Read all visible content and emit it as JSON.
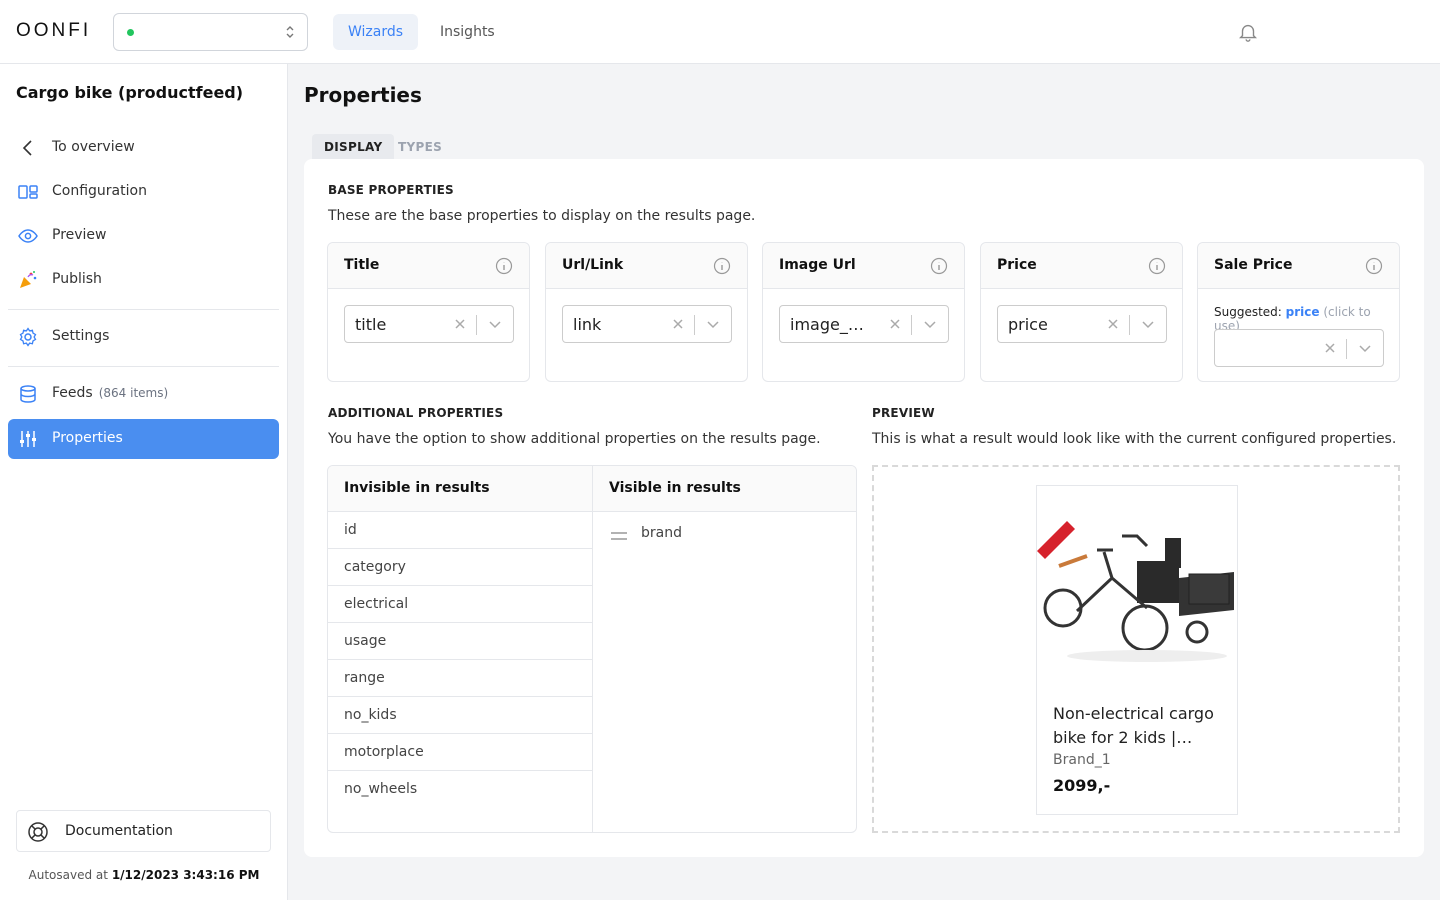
{
  "app": {
    "logo": "OONFI"
  },
  "topnav": {
    "tabs": [
      {
        "label": "Wizards",
        "active": true
      },
      {
        "label": "Insights",
        "active": false
      }
    ]
  },
  "sidebar": {
    "feed_title": "Cargo bike (productfeed)",
    "items": [
      {
        "label": "To overview",
        "icon": "chevron-left-icon"
      },
      {
        "label": "Configuration",
        "icon": "layout-icon"
      },
      {
        "label": "Preview",
        "icon": "eye-icon"
      },
      {
        "label": "Publish",
        "icon": "party-popper-icon"
      },
      {
        "label": "Settings",
        "icon": "gear-icon"
      },
      {
        "label": "Feeds",
        "count": "(864 items)",
        "icon": "database-icon"
      },
      {
        "label": "Properties",
        "icon": "sliders-icon",
        "active": true
      }
    ],
    "documentation": "Documentation",
    "autosave_prefix": "Autosaved at",
    "autosave_time": "1/12/2023 3:43:16 PM"
  },
  "main": {
    "title": "Properties",
    "tabs": [
      {
        "label": "DISPLAY",
        "active": true
      },
      {
        "label": "TYPES",
        "active": false
      }
    ],
    "base": {
      "heading": "BASE PROPERTIES",
      "description": "These are the base properties to display on the results page.",
      "fields": [
        {
          "name": "Title",
          "value": "title"
        },
        {
          "name": "Url/Link",
          "value": "link"
        },
        {
          "name": "Image Url",
          "value": "image_link"
        },
        {
          "name": "Price",
          "value": "price"
        },
        {
          "name": "Sale Price",
          "value": "",
          "suggested_label": "Suggested:",
          "suggested_value": "price",
          "suggested_hint": "(click to use)"
        }
      ]
    },
    "additional": {
      "heading": "ADDITIONAL PROPERTIES",
      "description": "You have the option to show additional properties on the results page.",
      "invisible_header": "Invisible in results",
      "visible_header": "Visible in results",
      "invisible": [
        "id",
        "category",
        "electrical",
        "usage",
        "range",
        "no_kids",
        "motorplace",
        "no_wheels"
      ],
      "visible": [
        "brand"
      ]
    },
    "preview": {
      "heading": "PREVIEW",
      "description": "This is what a result would look like with the current configured properties.",
      "product": {
        "name": "Non-electrical cargo bike for 2 kids |…",
        "brand": "Brand_1",
        "price": "2099,-"
      }
    }
  },
  "colors": {
    "accent": "#3b82f6",
    "active_nav": "#4a8ef0",
    "status_dot": "#22c55e"
  }
}
